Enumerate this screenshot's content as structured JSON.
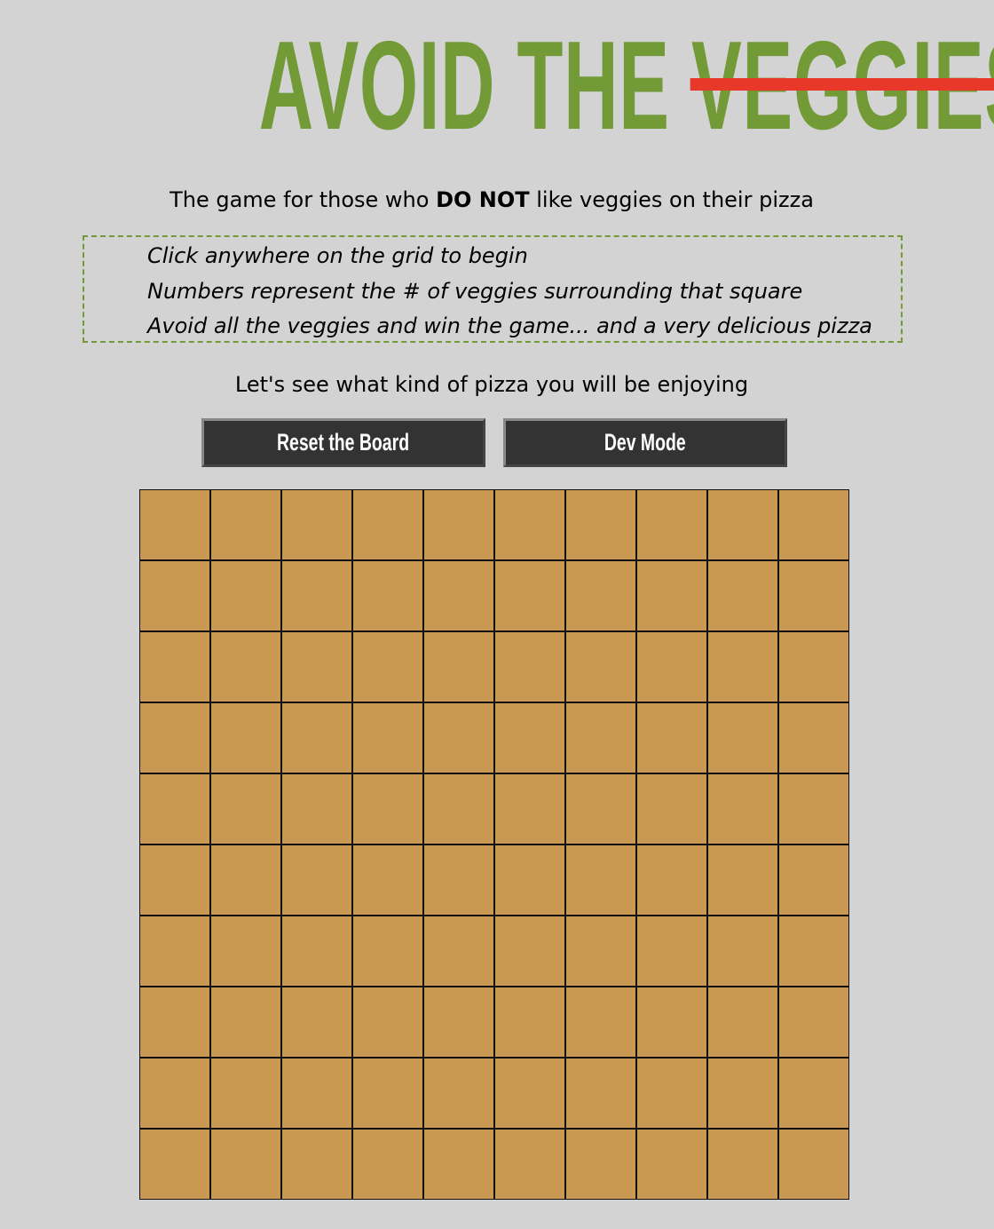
{
  "header": {
    "title_lead": "AVOID THE ",
    "title_struck": "VEGGIES",
    "title_color": "#729a37",
    "strike_color": "#e8382a"
  },
  "subtitle": {
    "before": "The game for those who ",
    "bold": "DO NOT",
    "after": " like veggies on their pizza"
  },
  "instructions": [
    "Click anywhere on the grid to begin",
    "Numbers represent the # of veggies surrounding that square",
    "Avoid all the veggies and win the game... and a very delicious pizza"
  ],
  "tagline": "Let's see what kind of pizza you will be enjoying",
  "buttons": {
    "reset_label": "Reset the Board",
    "dev_label": "Dev Mode"
  },
  "board": {
    "rows": 10,
    "cols": 10,
    "cell_color": "#c99953",
    "state": "unrevealed"
  }
}
